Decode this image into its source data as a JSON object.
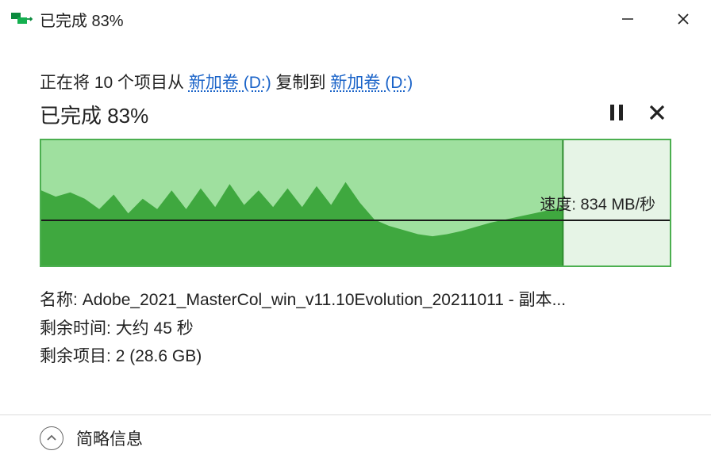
{
  "titlebar": {
    "text": "已完成 83%"
  },
  "copy_line": {
    "prefix": "正在将 10 个项目从 ",
    "source": "新加卷 (D:)",
    "middle": " 复制到 ",
    "dest": "新加卷 (D:)"
  },
  "progress": {
    "text": "已完成 83%"
  },
  "speed": {
    "label": "速度:",
    "value": "834 MB/秒"
  },
  "details": {
    "name_label": "名称:",
    "name_value": "Adobe_2021_MasterCol_win_v11.10Evolution_20211011 - 副本...",
    "time_label": "剩余时间:",
    "time_value": "大约 45 秒",
    "items_label": "剩余项目:",
    "items_value": "2 (28.6 GB)"
  },
  "footer": {
    "toggle_label": "简略信息"
  },
  "chart_data": {
    "type": "area",
    "title": "传输速度",
    "ylabel": "MB/秒",
    "ylim": [
      0,
      1200
    ],
    "progress_pct": 83,
    "current_speed": 834,
    "values": [
      720,
      660,
      700,
      640,
      540,
      680,
      500,
      640,
      540,
      720,
      540,
      740,
      560,
      780,
      580,
      720,
      560,
      740,
      560,
      760,
      580,
      800,
      600,
      440,
      380,
      340,
      300,
      280,
      300,
      330,
      370,
      410,
      440,
      470,
      500,
      530,
      560
    ]
  }
}
